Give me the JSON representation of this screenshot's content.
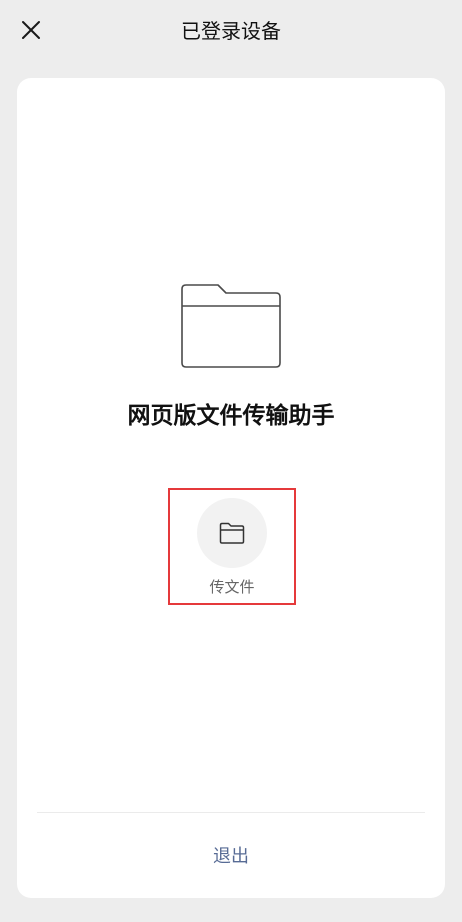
{
  "header": {
    "title": "已登录设备",
    "close_icon": "close-icon"
  },
  "device": {
    "icon": "folder-icon",
    "name": "网页版文件传输助手"
  },
  "actions": [
    {
      "icon": "folder-icon",
      "label": "传文件"
    }
  ],
  "footer": {
    "logout_label": "退出"
  },
  "colors": {
    "background": "#ededed",
    "card": "#ffffff",
    "link": "#576b95",
    "highlight_border": "#e5393b"
  }
}
